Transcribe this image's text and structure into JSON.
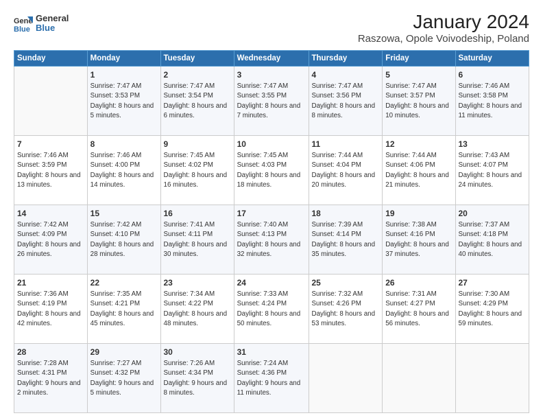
{
  "logo": {
    "general": "General",
    "blue": "Blue"
  },
  "title": "January 2024",
  "subtitle": "Raszowa, Opole Voivodeship, Poland",
  "days": [
    "Sunday",
    "Monday",
    "Tuesday",
    "Wednesday",
    "Thursday",
    "Friday",
    "Saturday"
  ],
  "weeks": [
    [
      {
        "day": "",
        "sunrise": "",
        "sunset": "",
        "daylight": ""
      },
      {
        "day": "1",
        "sunrise": "Sunrise: 7:47 AM",
        "sunset": "Sunset: 3:53 PM",
        "daylight": "Daylight: 8 hours and 5 minutes."
      },
      {
        "day": "2",
        "sunrise": "Sunrise: 7:47 AM",
        "sunset": "Sunset: 3:54 PM",
        "daylight": "Daylight: 8 hours and 6 minutes."
      },
      {
        "day": "3",
        "sunrise": "Sunrise: 7:47 AM",
        "sunset": "Sunset: 3:55 PM",
        "daylight": "Daylight: 8 hours and 7 minutes."
      },
      {
        "day": "4",
        "sunrise": "Sunrise: 7:47 AM",
        "sunset": "Sunset: 3:56 PM",
        "daylight": "Daylight: 8 hours and 8 minutes."
      },
      {
        "day": "5",
        "sunrise": "Sunrise: 7:47 AM",
        "sunset": "Sunset: 3:57 PM",
        "daylight": "Daylight: 8 hours and 10 minutes."
      },
      {
        "day": "6",
        "sunrise": "Sunrise: 7:46 AM",
        "sunset": "Sunset: 3:58 PM",
        "daylight": "Daylight: 8 hours and 11 minutes."
      }
    ],
    [
      {
        "day": "7",
        "sunrise": "Sunrise: 7:46 AM",
        "sunset": "Sunset: 3:59 PM",
        "daylight": "Daylight: 8 hours and 13 minutes."
      },
      {
        "day": "8",
        "sunrise": "Sunrise: 7:46 AM",
        "sunset": "Sunset: 4:00 PM",
        "daylight": "Daylight: 8 hours and 14 minutes."
      },
      {
        "day": "9",
        "sunrise": "Sunrise: 7:45 AM",
        "sunset": "Sunset: 4:02 PM",
        "daylight": "Daylight: 8 hours and 16 minutes."
      },
      {
        "day": "10",
        "sunrise": "Sunrise: 7:45 AM",
        "sunset": "Sunset: 4:03 PM",
        "daylight": "Daylight: 8 hours and 18 minutes."
      },
      {
        "day": "11",
        "sunrise": "Sunrise: 7:44 AM",
        "sunset": "Sunset: 4:04 PM",
        "daylight": "Daylight: 8 hours and 20 minutes."
      },
      {
        "day": "12",
        "sunrise": "Sunrise: 7:44 AM",
        "sunset": "Sunset: 4:06 PM",
        "daylight": "Daylight: 8 hours and 21 minutes."
      },
      {
        "day": "13",
        "sunrise": "Sunrise: 7:43 AM",
        "sunset": "Sunset: 4:07 PM",
        "daylight": "Daylight: 8 hours and 24 minutes."
      }
    ],
    [
      {
        "day": "14",
        "sunrise": "Sunrise: 7:42 AM",
        "sunset": "Sunset: 4:09 PM",
        "daylight": "Daylight: 8 hours and 26 minutes."
      },
      {
        "day": "15",
        "sunrise": "Sunrise: 7:42 AM",
        "sunset": "Sunset: 4:10 PM",
        "daylight": "Daylight: 8 hours and 28 minutes."
      },
      {
        "day": "16",
        "sunrise": "Sunrise: 7:41 AM",
        "sunset": "Sunset: 4:11 PM",
        "daylight": "Daylight: 8 hours and 30 minutes."
      },
      {
        "day": "17",
        "sunrise": "Sunrise: 7:40 AM",
        "sunset": "Sunset: 4:13 PM",
        "daylight": "Daylight: 8 hours and 32 minutes."
      },
      {
        "day": "18",
        "sunrise": "Sunrise: 7:39 AM",
        "sunset": "Sunset: 4:14 PM",
        "daylight": "Daylight: 8 hours and 35 minutes."
      },
      {
        "day": "19",
        "sunrise": "Sunrise: 7:38 AM",
        "sunset": "Sunset: 4:16 PM",
        "daylight": "Daylight: 8 hours and 37 minutes."
      },
      {
        "day": "20",
        "sunrise": "Sunrise: 7:37 AM",
        "sunset": "Sunset: 4:18 PM",
        "daylight": "Daylight: 8 hours and 40 minutes."
      }
    ],
    [
      {
        "day": "21",
        "sunrise": "Sunrise: 7:36 AM",
        "sunset": "Sunset: 4:19 PM",
        "daylight": "Daylight: 8 hours and 42 minutes."
      },
      {
        "day": "22",
        "sunrise": "Sunrise: 7:35 AM",
        "sunset": "Sunset: 4:21 PM",
        "daylight": "Daylight: 8 hours and 45 minutes."
      },
      {
        "day": "23",
        "sunrise": "Sunrise: 7:34 AM",
        "sunset": "Sunset: 4:22 PM",
        "daylight": "Daylight: 8 hours and 48 minutes."
      },
      {
        "day": "24",
        "sunrise": "Sunrise: 7:33 AM",
        "sunset": "Sunset: 4:24 PM",
        "daylight": "Daylight: 8 hours and 50 minutes."
      },
      {
        "day": "25",
        "sunrise": "Sunrise: 7:32 AM",
        "sunset": "Sunset: 4:26 PM",
        "daylight": "Daylight: 8 hours and 53 minutes."
      },
      {
        "day": "26",
        "sunrise": "Sunrise: 7:31 AM",
        "sunset": "Sunset: 4:27 PM",
        "daylight": "Daylight: 8 hours and 56 minutes."
      },
      {
        "day": "27",
        "sunrise": "Sunrise: 7:30 AM",
        "sunset": "Sunset: 4:29 PM",
        "daylight": "Daylight: 8 hours and 59 minutes."
      }
    ],
    [
      {
        "day": "28",
        "sunrise": "Sunrise: 7:28 AM",
        "sunset": "Sunset: 4:31 PM",
        "daylight": "Daylight: 9 hours and 2 minutes."
      },
      {
        "day": "29",
        "sunrise": "Sunrise: 7:27 AM",
        "sunset": "Sunset: 4:32 PM",
        "daylight": "Daylight: 9 hours and 5 minutes."
      },
      {
        "day": "30",
        "sunrise": "Sunrise: 7:26 AM",
        "sunset": "Sunset: 4:34 PM",
        "daylight": "Daylight: 9 hours and 8 minutes."
      },
      {
        "day": "31",
        "sunrise": "Sunrise: 7:24 AM",
        "sunset": "Sunset: 4:36 PM",
        "daylight": "Daylight: 9 hours and 11 minutes."
      },
      {
        "day": "",
        "sunrise": "",
        "sunset": "",
        "daylight": ""
      },
      {
        "day": "",
        "sunrise": "",
        "sunset": "",
        "daylight": ""
      },
      {
        "day": "",
        "sunrise": "",
        "sunset": "",
        "daylight": ""
      }
    ]
  ]
}
